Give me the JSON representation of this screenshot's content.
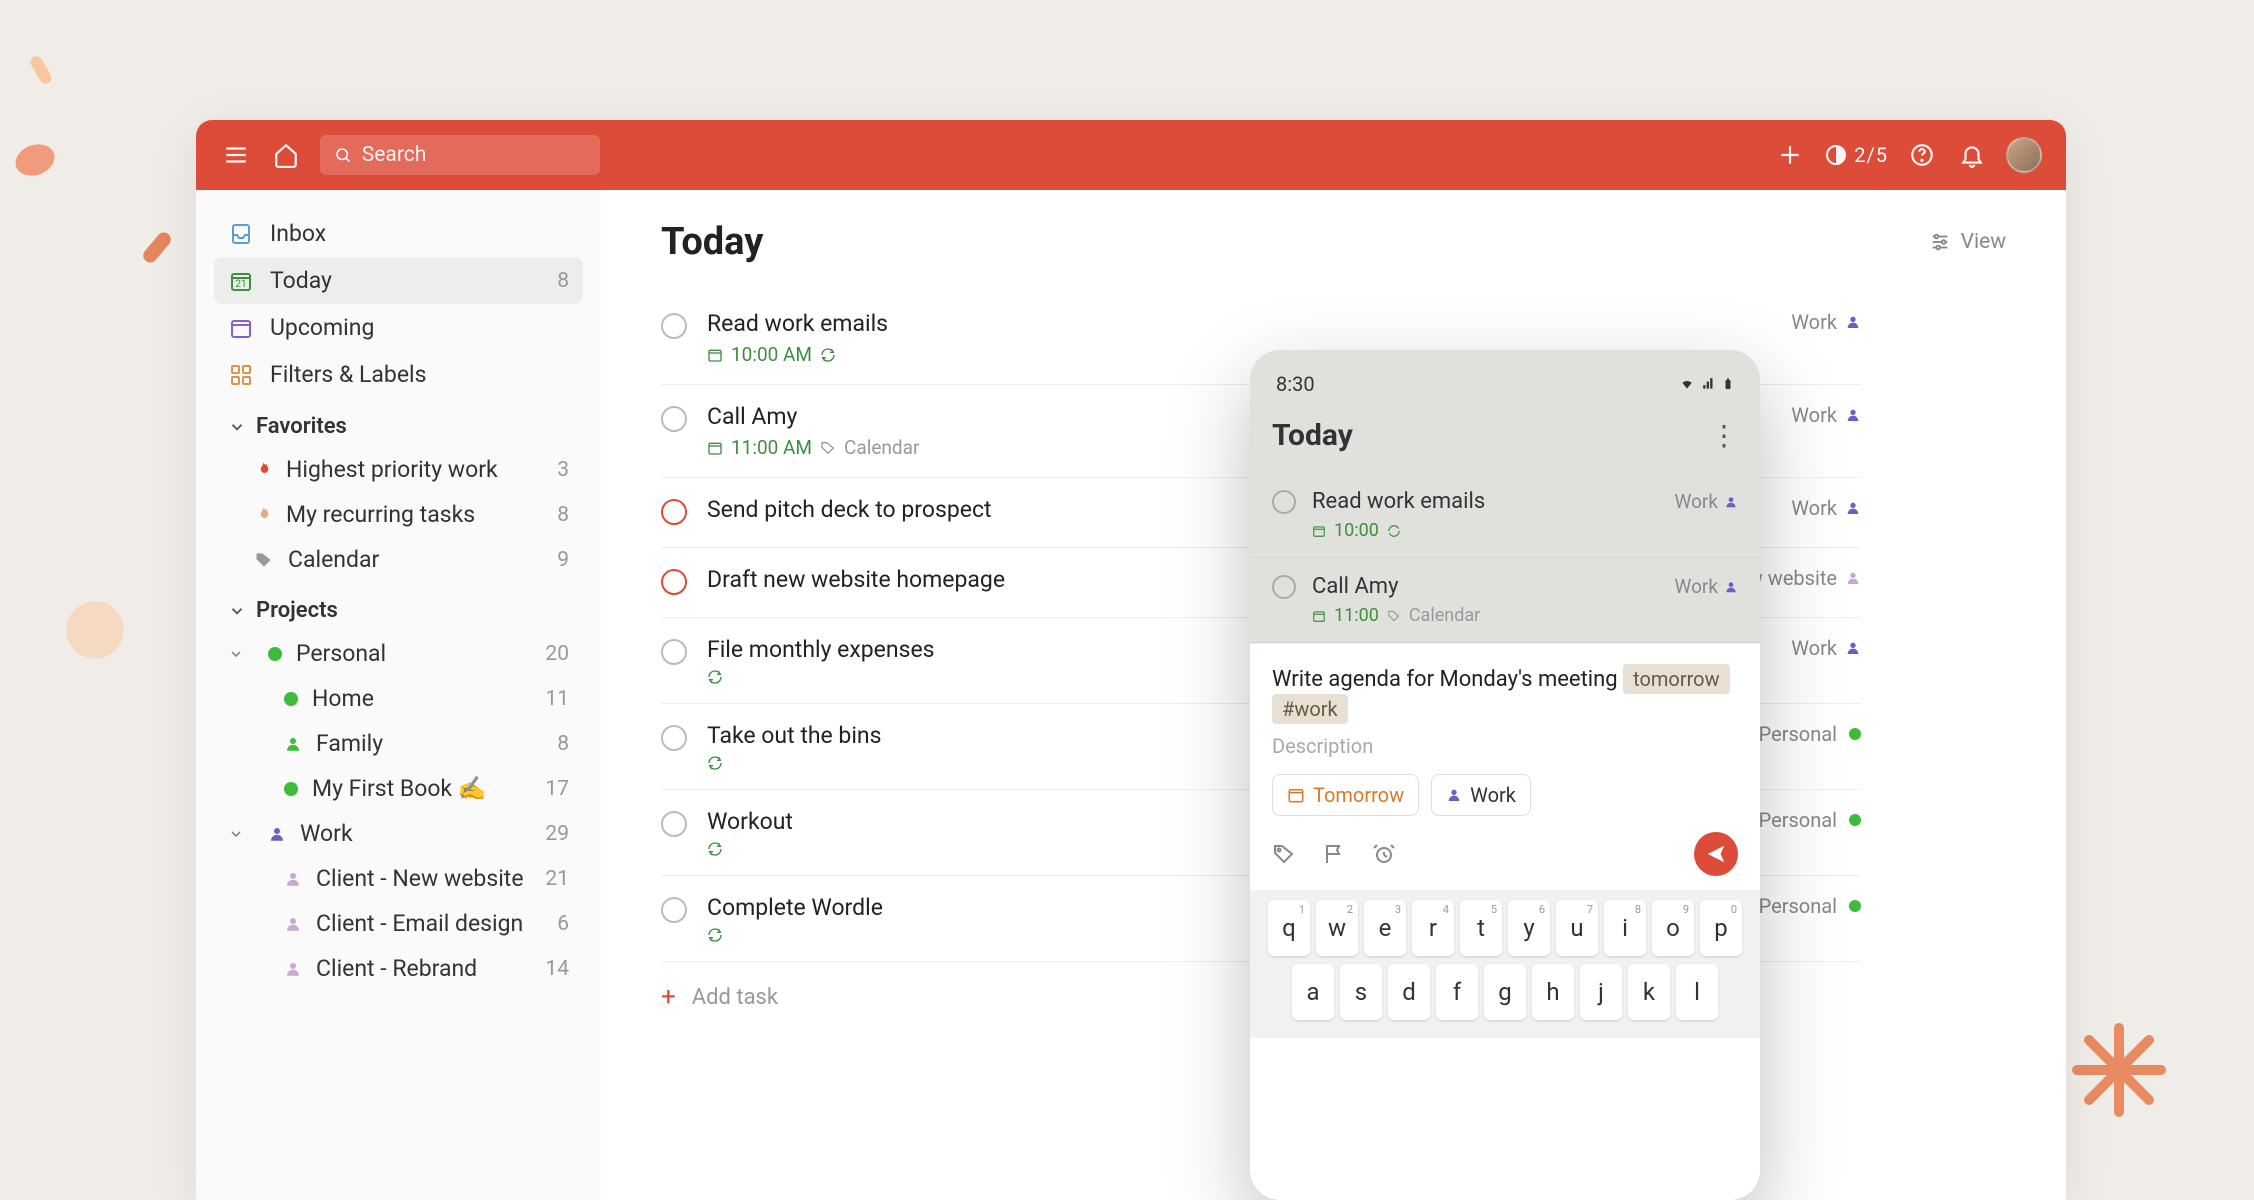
{
  "header": {
    "search_placeholder": "Search",
    "progress": "2/5"
  },
  "sidebar": {
    "nav": {
      "inbox": "Inbox",
      "today": "Today",
      "today_count": "8",
      "upcoming": "Upcoming",
      "filters": "Filters & Labels"
    },
    "favorites_label": "Favorites",
    "favorites": [
      {
        "label": "Highest priority work",
        "count": "3"
      },
      {
        "label": "My recurring tasks",
        "count": "8"
      },
      {
        "label": "Calendar",
        "count": "9"
      }
    ],
    "projects_label": "Projects",
    "projects": [
      {
        "label": "Personal",
        "count": "20",
        "color": "#3dbb3d"
      },
      {
        "label": "Home",
        "count": "11",
        "color": "#3dbb3d",
        "indent": true
      },
      {
        "label": "Family",
        "count": "8",
        "person": "#3dbb3d",
        "indent": true
      },
      {
        "label": "My First Book ✍️",
        "count": "17",
        "color": "#3dbb3d",
        "indent": true
      },
      {
        "label": "Work",
        "count": "29",
        "person": "#6b5fc7"
      },
      {
        "label": "Client - New website",
        "count": "21",
        "person": "#c9a8d4",
        "indent": true
      },
      {
        "label": "Client - Email design",
        "count": "6",
        "person": "#c9a8d4",
        "indent": true
      },
      {
        "label": "Client - Rebrand",
        "count": "14",
        "person": "#c9a8d4",
        "indent": true
      }
    ]
  },
  "main": {
    "title": "Today",
    "view_label": "View",
    "add_task": "Add task",
    "tasks": [
      {
        "title": "Read work emails",
        "time": "10:00 AM",
        "recurring": true,
        "project": "Work",
        "project_type": "person",
        "project_color": "#6b5fc7"
      },
      {
        "title": "Call Amy",
        "time": "11:00 AM",
        "tag": "Calendar",
        "project": "Work",
        "project_type": "person",
        "project_color": "#6b5fc7"
      },
      {
        "title": "Send pitch deck to prospect",
        "priority": "p1",
        "project": "Work",
        "project_type": "person",
        "project_color": "#6b5fc7"
      },
      {
        "title": "Draft new website homepage",
        "priority": "p1",
        "project": "Client - New website",
        "project_type": "person",
        "project_color": "#c9a8d4"
      },
      {
        "title": "File monthly expenses",
        "recurring": true,
        "project": "Work",
        "project_type": "person",
        "project_color": "#6b5fc7"
      },
      {
        "title": "Take out the bins",
        "recurring": true,
        "project": "Personal",
        "project_type": "dot",
        "project_color": "#3dbb3d"
      },
      {
        "title": "Workout",
        "recurring": true,
        "project": "Personal",
        "project_type": "dot",
        "project_color": "#3dbb3d"
      },
      {
        "title": "Complete Wordle",
        "recurring": true,
        "project": "Personal",
        "project_type": "dot",
        "project_color": "#3dbb3d"
      }
    ]
  },
  "phone": {
    "time": "8:30",
    "title": "Today",
    "tasks": [
      {
        "title": "Read work emails",
        "time": "10:00",
        "recurring": true,
        "project": "Work"
      },
      {
        "title": "Call Amy",
        "time": "11:00",
        "tag": "Calendar",
        "project": "Work"
      }
    ],
    "compose": {
      "text": "Write agenda for Monday's meeting",
      "date_pill": "tomorrow",
      "tag_pill": "#work",
      "description_placeholder": "Description",
      "tomorrow_chip": "Tomorrow",
      "work_chip": "Work"
    },
    "keyboard": {
      "row1": [
        "q",
        "w",
        "e",
        "r",
        "t",
        "y",
        "u",
        "i",
        "o",
        "p"
      ],
      "row1_nums": [
        "1",
        "2",
        "3",
        "4",
        "5",
        "6",
        "7",
        "8",
        "9",
        "0"
      ],
      "row2": [
        "a",
        "s",
        "d",
        "f",
        "g",
        "h",
        "j",
        "k",
        "l"
      ]
    }
  }
}
